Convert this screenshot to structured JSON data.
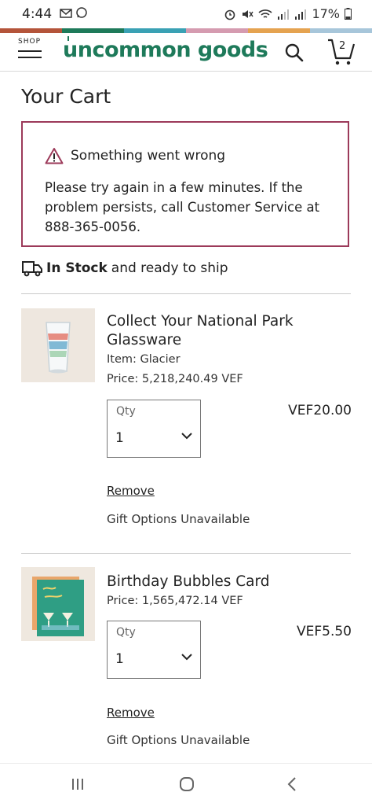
{
  "status_bar": {
    "time": "4:44",
    "left_icons": [
      "mail-icon",
      "whatsapp-icon"
    ],
    "right_icons": [
      "alarm-icon",
      "mute-icon",
      "wifi-icon",
      "signal-icon",
      "signal-icon"
    ],
    "battery": "17%"
  },
  "brand_stripe_colors": [
    "#b4543a",
    "#1e7a5a",
    "#3aa1b4",
    "#d59bb0",
    "#e5a350",
    "#a7c6da"
  ],
  "header": {
    "shop_label": "SHOP",
    "logo_text": "uncommon goods",
    "cart_count": "2",
    "accent_color": "#1e7a5a"
  },
  "page_title": "Your Cart",
  "alert": {
    "title": "Something went wrong",
    "message": "Please try again in a few minutes. If the problem persists, call Customer Service at 888-365-0056.",
    "border_color": "#9c3a5a"
  },
  "shipping": {
    "bold": "In Stock",
    "rest": "and ready to ship"
  },
  "cart_items": [
    {
      "name": "Collect Your National Park Glassware",
      "item_line": "Item: Glacier",
      "price_line": "Price: 5,218,240.49 VEF",
      "qty_label": "Qty",
      "qty_value": "1",
      "total": "VEF20.00",
      "remove_label": "Remove",
      "gift_label": "Gift Options Unavailable"
    },
    {
      "name": "Birthday Bubbles Card",
      "price_line": "Price: 1,565,472.14 VEF",
      "qty_label": "Qty",
      "qty_value": "1",
      "total": "VEF5.50",
      "remove_label": "Remove",
      "gift_label": "Gift Options Unavailable"
    }
  ],
  "nav_bar": [
    "recent-apps-icon",
    "home-icon",
    "back-icon"
  ]
}
